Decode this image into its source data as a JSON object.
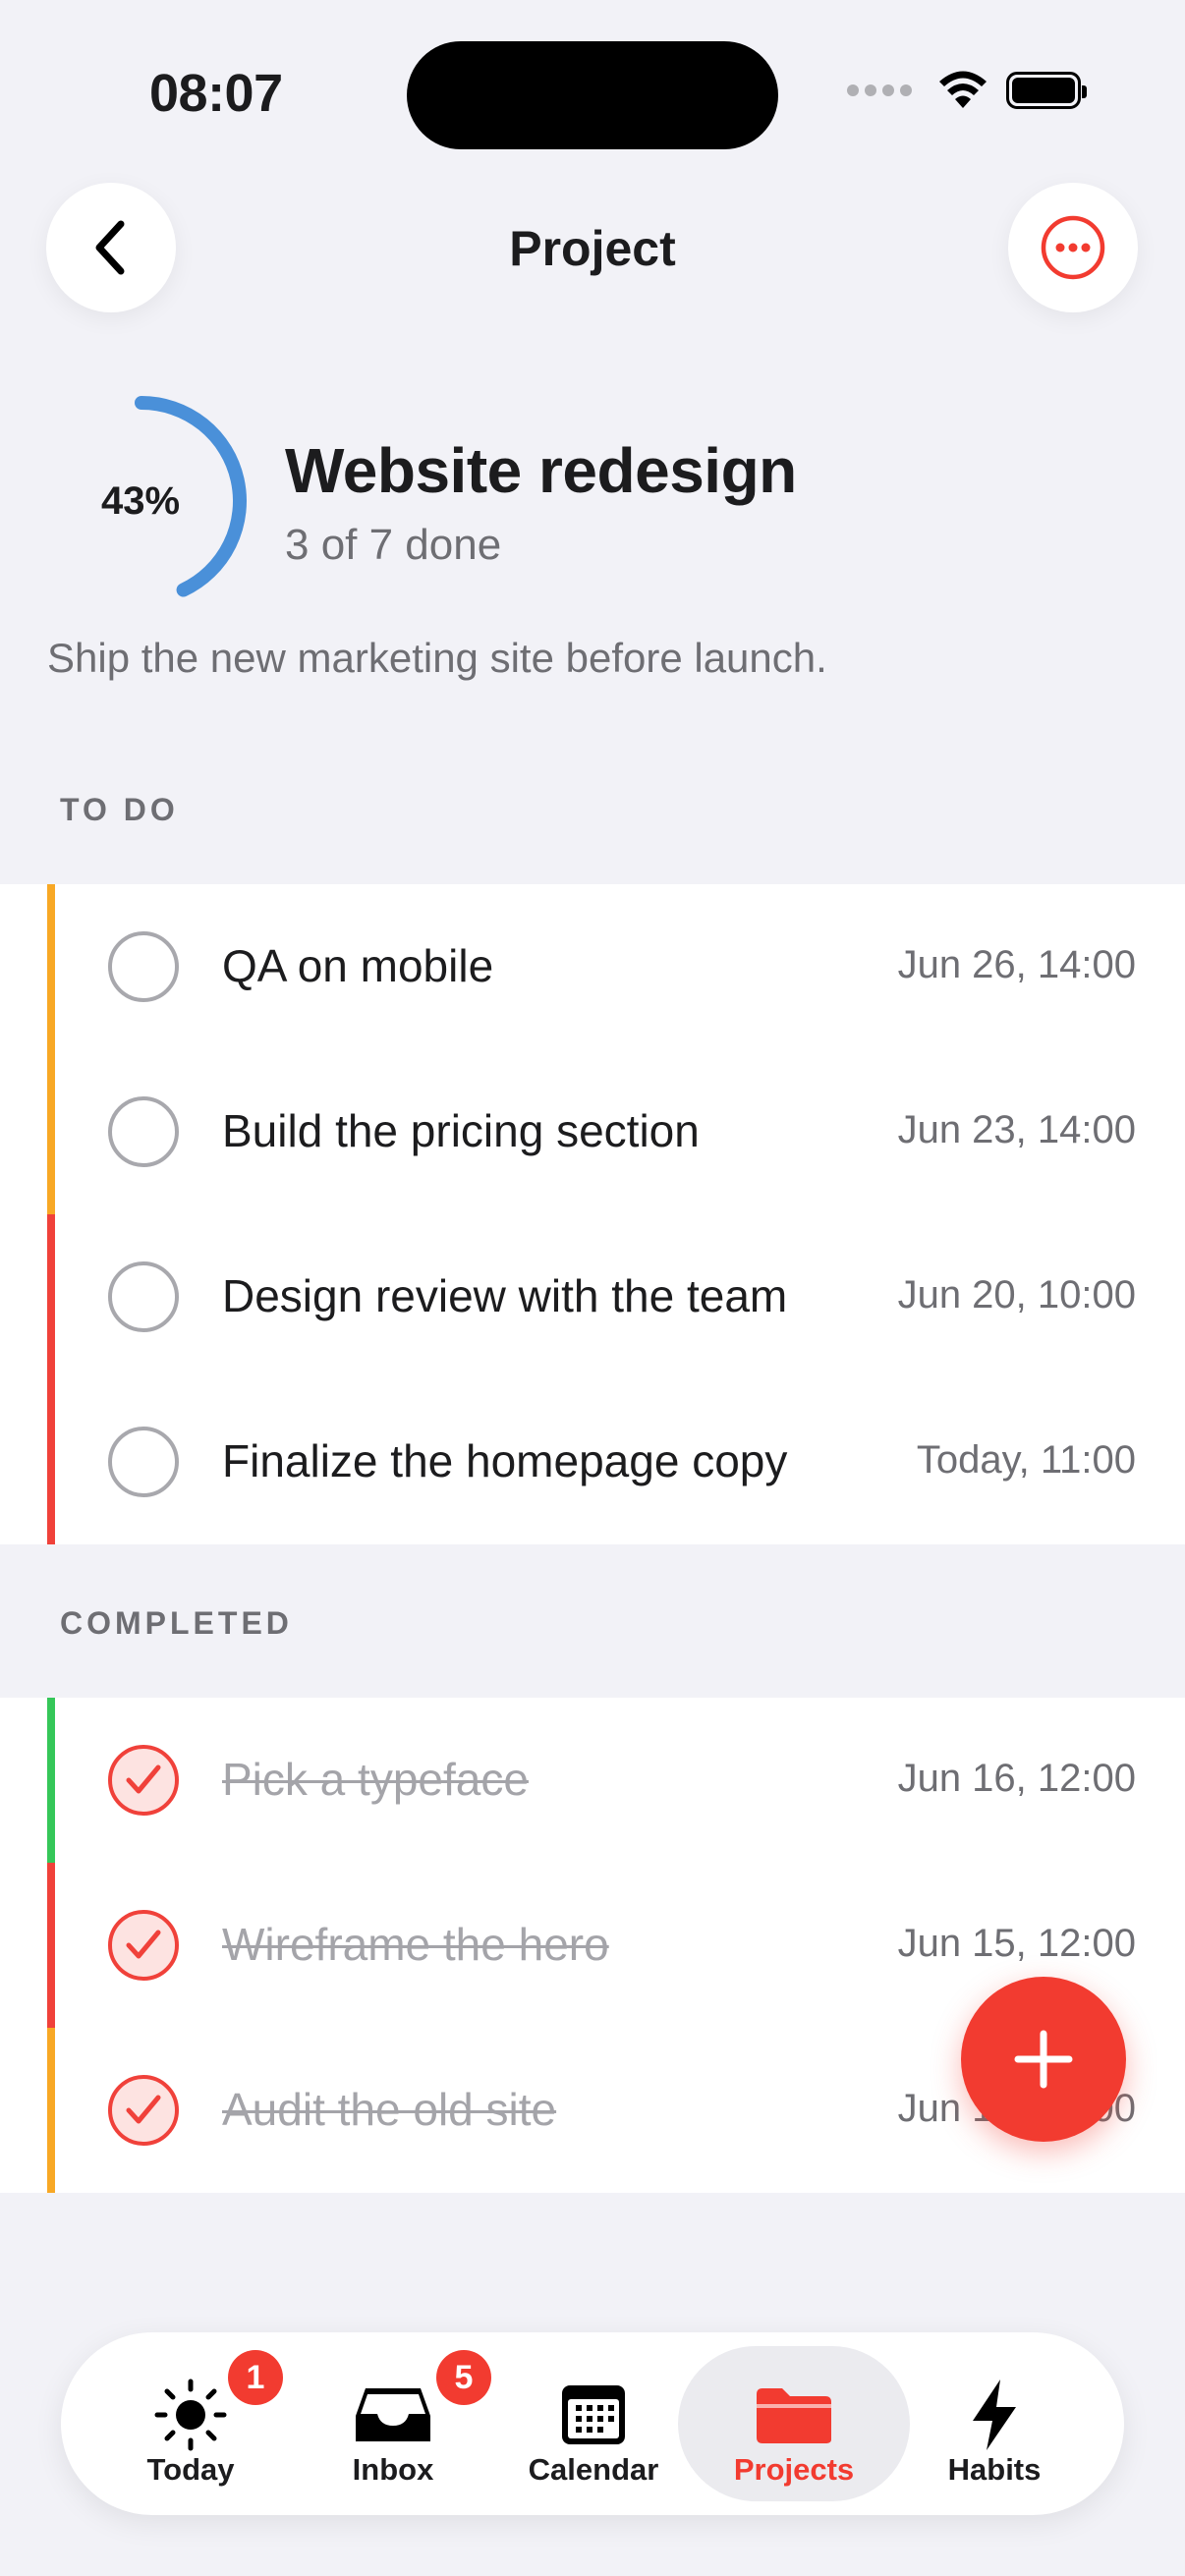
{
  "status_bar": {
    "time": "08:07"
  },
  "nav": {
    "title": "Project"
  },
  "project": {
    "progress_label": "43%",
    "progress_fraction": 0.43,
    "title": "Website redesign",
    "subtitle": "3 of 7 done",
    "description": "Ship the new marketing site before launch."
  },
  "sections": {
    "todo": "TO DO",
    "completed": "COMPLETED"
  },
  "todo_tasks": [
    {
      "title": "QA on mobile",
      "date": "Jun 26, 14:00",
      "priority_color": "#f8a825"
    },
    {
      "title": "Build the pricing section",
      "date": "Jun 23, 14:00",
      "priority_color": "#f8a825"
    },
    {
      "title": "Design review with the team",
      "date": "Jun 20, 10:00",
      "priority_color": "#f0413a"
    },
    {
      "title": "Finalize the homepage copy",
      "date": "Today, 11:00",
      "priority_color": "#f0413a"
    }
  ],
  "completed_tasks": [
    {
      "title": "Pick a typeface",
      "date": "Jun 16, 12:00",
      "priority_color": "#35c759"
    },
    {
      "title": "Wireframe the hero",
      "date": "Jun 15, 12:00",
      "priority_color": "#f0413a"
    },
    {
      "title": "Audit the old site",
      "date": "Jun 14, 12:00",
      "priority_color": "#f8a825"
    }
  ],
  "tabs": [
    {
      "label": "Today",
      "icon": "sun-icon",
      "badge": "1"
    },
    {
      "label": "Inbox",
      "icon": "inbox-tray-icon",
      "badge": "5"
    },
    {
      "label": "Calendar",
      "icon": "calendar-icon"
    },
    {
      "label": "Projects",
      "icon": "folder-icon",
      "active": true
    },
    {
      "label": "Habits",
      "icon": "bolt-icon"
    }
  ],
  "colors": {
    "accent": "#f23b30",
    "progress_ring": "#4a90d9",
    "background": "#f2f2f7"
  }
}
